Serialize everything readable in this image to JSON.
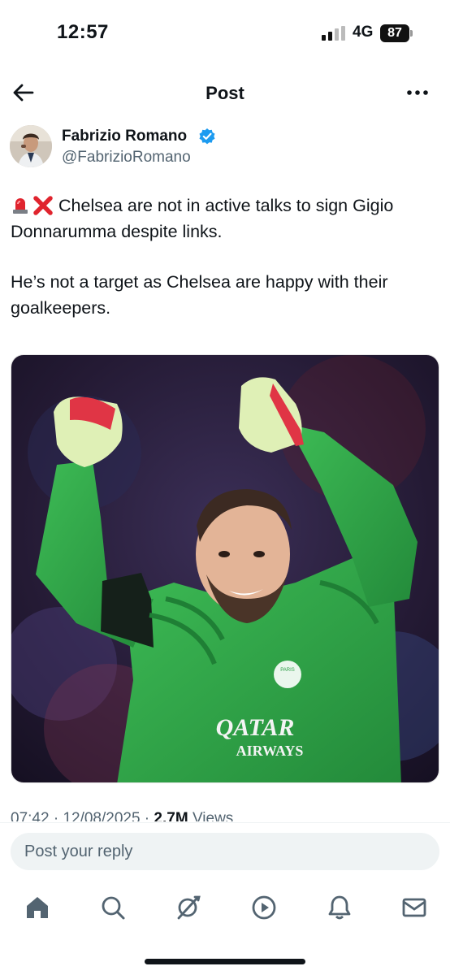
{
  "status_bar": {
    "time": "12:57",
    "network": "4G",
    "battery": "87"
  },
  "header": {
    "title": "Post",
    "back_icon": "arrow-left-icon",
    "more_icon": "more-horizontal-icon"
  },
  "author": {
    "name": "Fabrizio Romano",
    "handle": "@FabrizioRomano",
    "verified": true,
    "verified_color": "#1d9bf0"
  },
  "tweet": {
    "emojis": [
      "police-light-emoji",
      "cross-mark-emoji"
    ],
    "line1": "Chelsea are not in active talks to sign Gigio Donnarumma despite links.",
    "line2": "He’s not a target as Chelsea are happy with their goalkeepers."
  },
  "media": {
    "jersey_text_1": "QATAR",
    "jersey_text_2": "AIRWAYS",
    "crest_text": "PARIS"
  },
  "meta": {
    "time": "07:42",
    "date": "12/08/2025",
    "views_count": "2.7M",
    "views_label": "Views"
  },
  "reply": {
    "placeholder": "Post your reply"
  },
  "nav": {
    "items": [
      "home-icon",
      "search-icon",
      "grok-icon",
      "video-icon",
      "notifications-icon",
      "messages-icon"
    ]
  },
  "colors": {
    "accent": "#1d9bf0",
    "text": "#0f1419",
    "secondary": "#536471",
    "jersey_green": "#2b9e45"
  }
}
